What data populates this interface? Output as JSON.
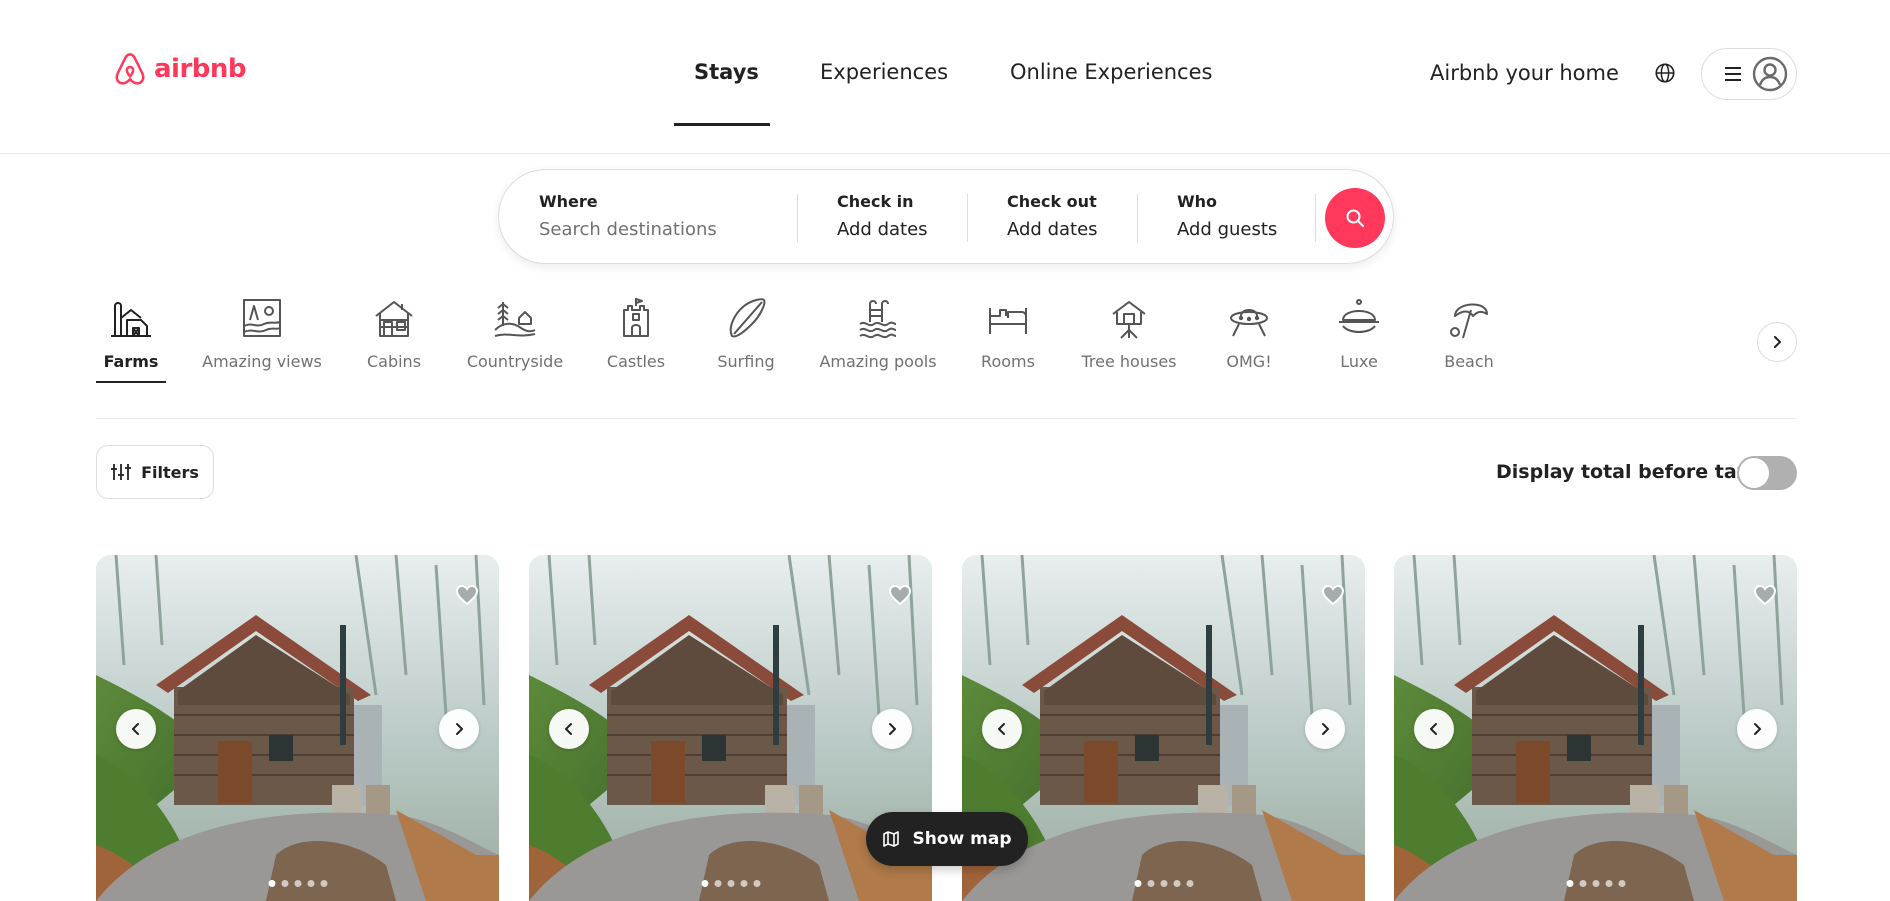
{
  "brand": {
    "name": "airbnb",
    "color": "#ff385c"
  },
  "nav": {
    "tabs": [
      {
        "label": "Stays",
        "active": true
      },
      {
        "label": "Experiences",
        "active": false
      },
      {
        "label": "Online Experiences",
        "active": false
      }
    ],
    "host_link": "Airbnb your home",
    "globe_icon": "globe-icon",
    "menu_icon": "hamburger-menu-icon",
    "avatar_icon": "user-avatar-icon"
  },
  "search": {
    "where_label": "Where",
    "where_placeholder": "Search destinations",
    "checkin_label": "Check in",
    "checkin_value": "Add dates",
    "checkout_label": "Check out",
    "checkout_value": "Add dates",
    "who_label": "Who",
    "who_value": "Add guests",
    "button_icon": "search-icon"
  },
  "categories": [
    {
      "label": "Farms",
      "icon": "farm-icon",
      "active": true
    },
    {
      "label": "Amazing views",
      "icon": "amazing-views-icon",
      "active": false
    },
    {
      "label": "Cabins",
      "icon": "cabin-icon",
      "active": false
    },
    {
      "label": "Countryside",
      "icon": "countryside-icon",
      "active": false
    },
    {
      "label": "Castles",
      "icon": "castle-icon",
      "active": false
    },
    {
      "label": "Surfing",
      "icon": "surfboard-icon",
      "active": false
    },
    {
      "label": "Amazing pools",
      "icon": "pool-icon",
      "active": false
    },
    {
      "label": "Rooms",
      "icon": "bed-icon",
      "active": false
    },
    {
      "label": "Tree houses",
      "icon": "tree-house-icon",
      "active": false
    },
    {
      "label": "OMG!",
      "icon": "ufo-icon",
      "active": false
    },
    {
      "label": "Luxe",
      "icon": "luxe-icon",
      "active": false
    },
    {
      "label": "Beach",
      "icon": "beach-umbrella-icon",
      "active": false
    }
  ],
  "filters": {
    "button_label": "Filters",
    "tax_toggle_label": "Display total before taxes",
    "tax_toggle_on": false
  },
  "listings": [
    {
      "photo": "cabin-in-misty-forest",
      "photo_count": 5,
      "current_photo": 1
    },
    {
      "photo": "cabin-in-misty-forest",
      "photo_count": 5,
      "current_photo": 1
    },
    {
      "photo": "cabin-in-misty-forest",
      "photo_count": 5,
      "current_photo": 1
    },
    {
      "photo": "cabin-in-misty-forest",
      "photo_count": 5,
      "current_photo": 1
    }
  ],
  "map_button": {
    "label": "Show map",
    "icon": "map-icon"
  }
}
